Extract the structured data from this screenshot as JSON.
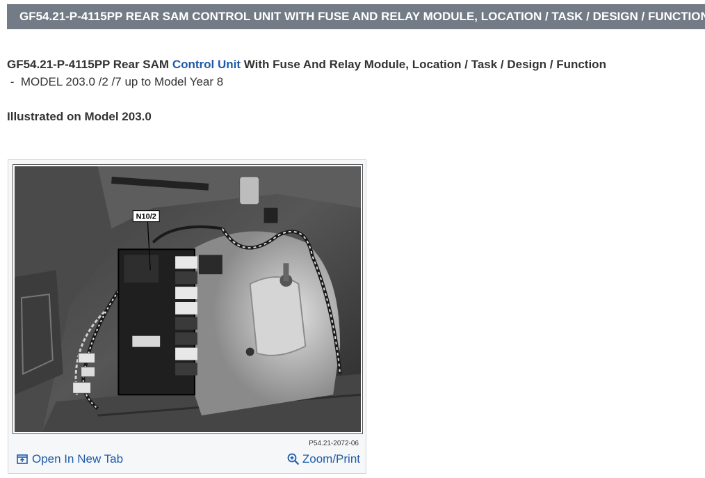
{
  "header": {
    "title": "GF54.21-P-4115PP REAR SAM CONTROL UNIT WITH FUSE AND RELAY MODULE, LOCATION / TASK / DESIGN / FUNCTION"
  },
  "document": {
    "heading_prefix": "GF54.21-P-4115PP Rear SAM ",
    "heading_link": "Control Unit",
    "heading_suffix": " With Fuse And Relay Module, Location / Task / Design / Function",
    "model_line": " -  MODEL 203.0 /2 /7 up to Model Year 8",
    "illustrated": "Illustrated on Model 203.0"
  },
  "figure": {
    "callout": "N10/2",
    "code": "P54.21-2072-06",
    "open_new_tab": "Open In New Tab",
    "zoom_print": "Zoom/Print"
  },
  "colors": {
    "title_bar": "#737c86",
    "link": "#1e5aa8"
  }
}
